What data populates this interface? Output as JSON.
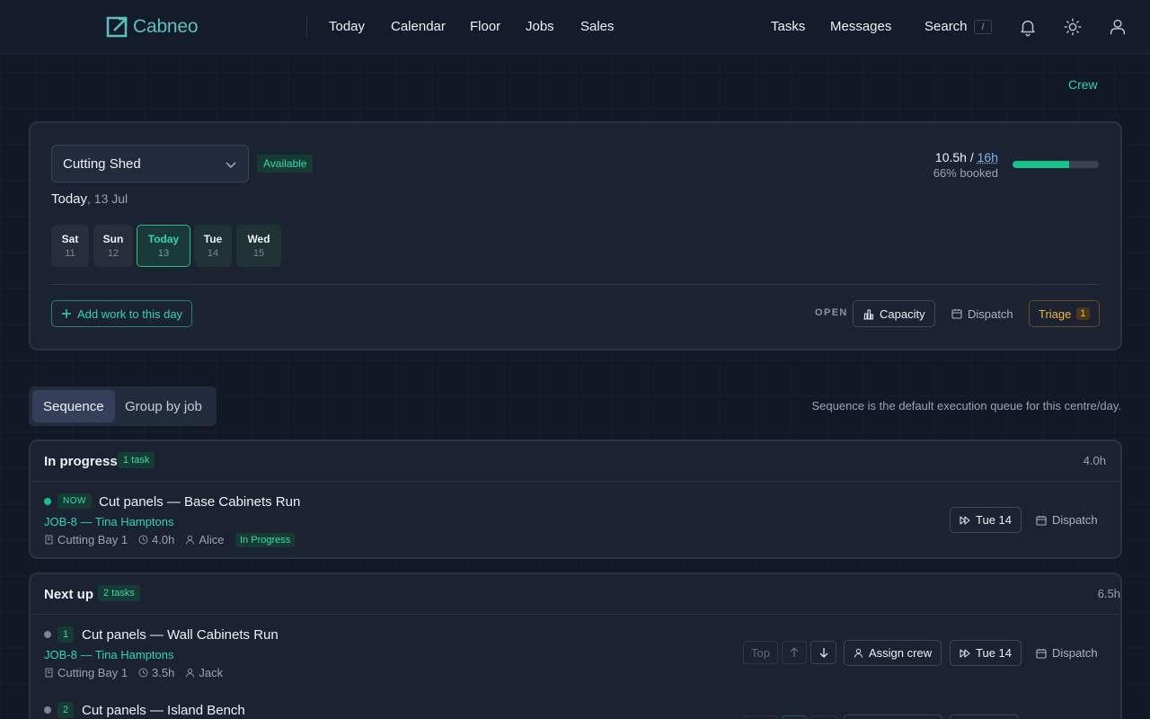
{
  "brand": {
    "name": "Cabneo"
  },
  "nav": {
    "today": "Today",
    "calendar": "Calendar",
    "floor": "Floor",
    "jobs": "Jobs",
    "sales": "Sales"
  },
  "header": {
    "tasks": "Tasks",
    "messages": "Messages",
    "search": "Search",
    "search_kbd": "/"
  },
  "crew_link": "Crew",
  "centre": {
    "selected": "Cutting Shed",
    "availability": "Available",
    "date_label": "Today",
    "date_value": ", 13 Jul",
    "booked_hours": "10.5h /",
    "total_hours": "16h",
    "booked_pct_text": "66% booked",
    "booked_fraction": 0.66
  },
  "days": [
    {
      "name": "Sat",
      "num": "11"
    },
    {
      "name": "Sun",
      "num": "12"
    },
    {
      "name": "Today",
      "num": "13"
    },
    {
      "name": "Tue",
      "num": "14"
    },
    {
      "name": "Wed",
      "num": "15"
    }
  ],
  "actions": {
    "add_work": "Add work to this day",
    "open_label": "OPEN",
    "capacity": "Capacity",
    "dispatch": "Dispatch",
    "triage": "Triage",
    "triage_count": "1"
  },
  "view_toggle": {
    "sequence": "Sequence",
    "group_by_job": "Group by job"
  },
  "view_hint": "Sequence is the default execution queue for this centre/day.",
  "sections": {
    "in_progress": {
      "title": "In progress",
      "count": "1 task",
      "hours": "4.0h",
      "task": {
        "badge": "NOW",
        "title": "Cut panels — Base Cabinets Run",
        "job": "JOB-8 — Tina Hamptons",
        "bay": "Cutting Bay 1",
        "hours": "4.0h",
        "crew": "Alice",
        "status": "In Progress",
        "reschedule": "Tue 14",
        "dispatch": "Dispatch"
      }
    },
    "next_up": {
      "title": "Next up",
      "count": "2 tasks",
      "hours": "6.5h",
      "tasks": [
        {
          "num": "1",
          "title": "Cut panels — Wall Cabinets Run",
          "job": "JOB-8 — Tina Hamptons",
          "bay": "Cutting Bay 1",
          "hours": "3.5h",
          "crew": "Jack",
          "top": "Top",
          "assign": "Assign crew",
          "reschedule": "Tue 14",
          "dispatch": "Dispatch"
        },
        {
          "num": "2",
          "title": "Cut panels — Island Bench"
        }
      ]
    }
  },
  "colors": {
    "accent": "#34d3b3",
    "bar_fill": "#16c28a",
    "triage": "#f3b341"
  }
}
